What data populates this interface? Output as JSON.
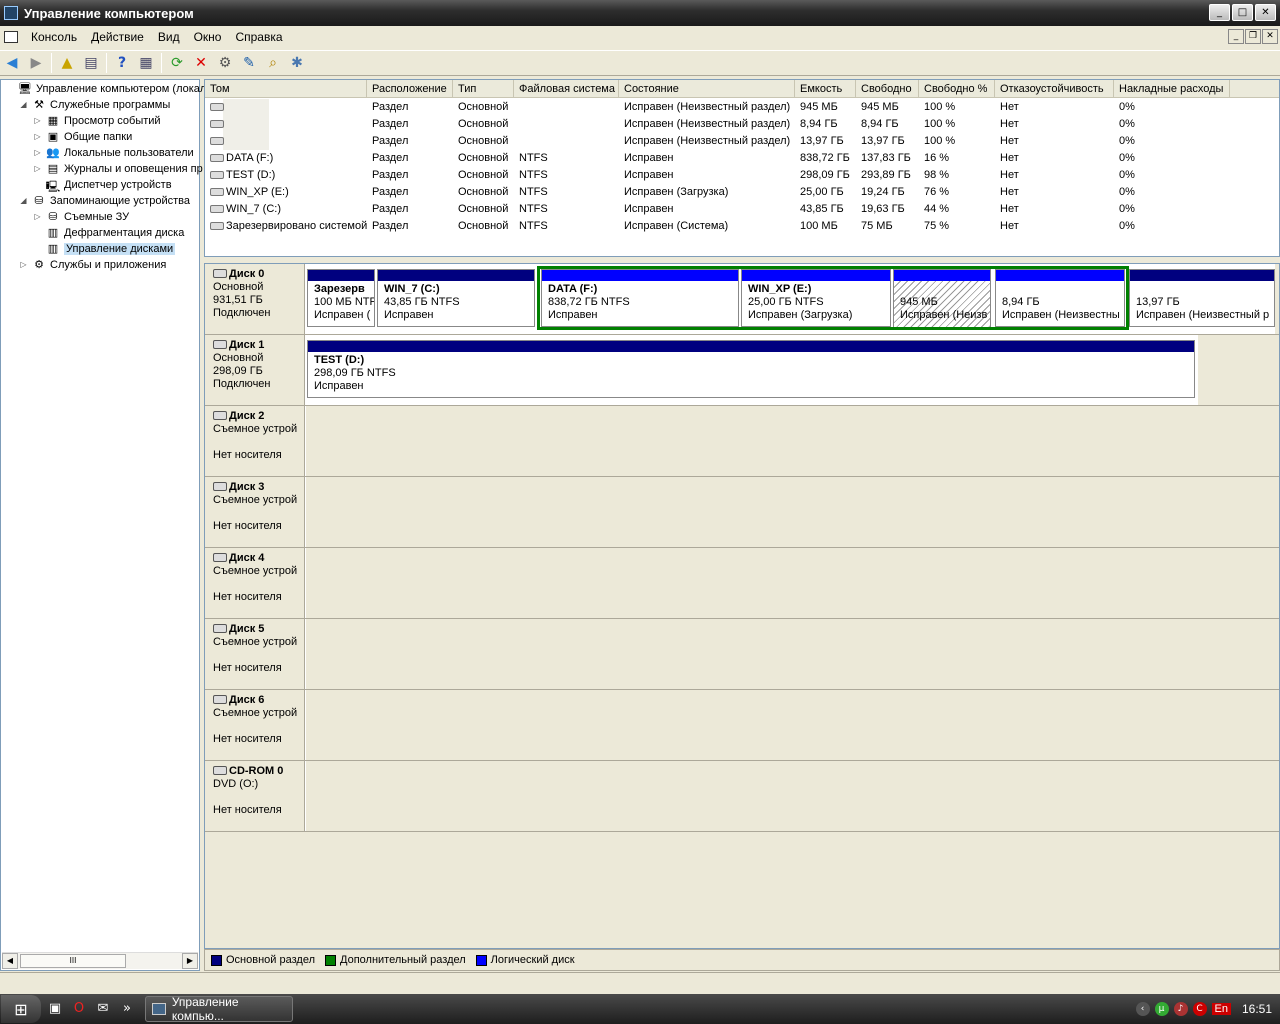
{
  "window": {
    "title": "Управление компьютером"
  },
  "menu": [
    "Консоль",
    "Действие",
    "Вид",
    "Окно",
    "Справка"
  ],
  "tree": {
    "items": [
      {
        "label": "Управление компьютером (локаль",
        "level": 0,
        "exp": ""
      },
      {
        "label": "Служебные программы",
        "level": 1,
        "exp": "◢"
      },
      {
        "label": "Просмотр событий",
        "level": 2,
        "exp": "▷"
      },
      {
        "label": "Общие папки",
        "level": 2,
        "exp": "▷"
      },
      {
        "label": "Локальные пользователи",
        "level": 2,
        "exp": "▷"
      },
      {
        "label": "Журналы и оповещения пр",
        "level": 2,
        "exp": "▷"
      },
      {
        "label": "Диспетчер устройств",
        "level": 2,
        "exp": ""
      },
      {
        "label": "Запоминающие устройства",
        "level": 1,
        "exp": "◢"
      },
      {
        "label": "Съемные ЗУ",
        "level": 2,
        "exp": "▷"
      },
      {
        "label": "Дефрагментация диска",
        "level": 2,
        "exp": ""
      },
      {
        "label": "Управление дисками",
        "level": 2,
        "exp": "",
        "selected": true
      },
      {
        "label": "Службы и приложения",
        "level": 1,
        "exp": "▷"
      }
    ],
    "scroll_thumb": "III"
  },
  "table": {
    "headers": [
      "Том",
      "Расположение",
      "Тип",
      "Файловая система",
      "Состояние",
      "Емкость",
      "Свободно",
      "Свободно %",
      "Отказоустойчивость",
      "Накладные расходы"
    ],
    "rows": [
      [
        "",
        "Раздел",
        "Основной",
        "",
        "Исправен (Неизвестный раздел)",
        "945 МБ",
        "945 МБ",
        "100 %",
        "Нет",
        "0%"
      ],
      [
        "",
        "Раздел",
        "Основной",
        "",
        "Исправен (Неизвестный раздел)",
        "8,94 ГБ",
        "8,94 ГБ",
        "100 %",
        "Нет",
        "0%"
      ],
      [
        "",
        "Раздел",
        "Основной",
        "",
        "Исправен (Неизвестный раздел)",
        "13,97 ГБ",
        "13,97 ГБ",
        "100 %",
        "Нет",
        "0%"
      ],
      [
        "DATA (F:)",
        "Раздел",
        "Основной",
        "NTFS",
        "Исправен",
        "838,72 ГБ",
        "137,83 ГБ",
        "16 %",
        "Нет",
        "0%"
      ],
      [
        "TEST (D:)",
        "Раздел",
        "Основной",
        "NTFS",
        "Исправен",
        "298,09 ГБ",
        "293,89 ГБ",
        "98 %",
        "Нет",
        "0%"
      ],
      [
        "WIN_XP (E:)",
        "Раздел",
        "Основной",
        "NTFS",
        "Исправен (Загрузка)",
        "25,00 ГБ",
        "19,24 ГБ",
        "76 %",
        "Нет",
        "0%"
      ],
      [
        "WIN_7 (C:)",
        "Раздел",
        "Основной",
        "NTFS",
        "Исправен",
        "43,85 ГБ",
        "19,63 ГБ",
        "44 %",
        "Нет",
        "0%"
      ],
      [
        "Зарезервировано системой",
        "Раздел",
        "Основной",
        "NTFS",
        "Исправен (Система)",
        "100 МБ",
        "75 МБ",
        "75 %",
        "Нет",
        "0%"
      ]
    ]
  },
  "disks": [
    {
      "name": "Диск 0",
      "type": "Основной",
      "size": "931,51 ГБ",
      "status": "Подключен",
      "partitions": [
        {
          "title": "Зарезерв",
          "size": "100 МБ NTF",
          "state": "Исправен (",
          "bar": "primary"
        },
        {
          "title": "WIN_7  (C:)",
          "size": "43,85 ГБ NTFS",
          "state": "Исправен",
          "bar": "primary"
        },
        {
          "title": "DATA  (F:)",
          "size": "838,72 ГБ NTFS",
          "state": "Исправен",
          "bar": "logical"
        },
        {
          "title": "WIN_XP  (E:)",
          "size": "25,00 ГБ NTFS",
          "state": "Исправен (Загрузка)",
          "bar": "logical"
        },
        {
          "title": "",
          "size": "945 МБ",
          "state": "Исправен (Неизв",
          "bar": "logical"
        },
        {
          "title": "",
          "size": "8,94 ГБ",
          "state": "Исправен (Неизвестны",
          "bar": "logical"
        },
        {
          "title": "",
          "size": "13,97 ГБ",
          "state": "Исправен (Неизвестный р",
          "bar": "primary"
        }
      ]
    },
    {
      "name": "Диск 1",
      "type": "Основной",
      "size": "298,09 ГБ",
      "status": "Подключен",
      "partitions": [
        {
          "title": "TEST  (D:)",
          "size": "298,09 ГБ NTFS",
          "state": "Исправен",
          "bar": "primary"
        }
      ]
    },
    {
      "name": "Диск 2",
      "type": "Съемное устрой",
      "status": "Нет носителя"
    },
    {
      "name": "Диск 3",
      "type": "Съемное устрой",
      "status": "Нет носителя"
    },
    {
      "name": "Диск 4",
      "type": "Съемное устрой",
      "status": "Нет носителя"
    },
    {
      "name": "Диск 5",
      "type": "Съемное устрой",
      "status": "Нет носителя"
    },
    {
      "name": "Диск 6",
      "type": "Съемное устрой",
      "status": "Нет носителя"
    },
    {
      "name": "CD-ROM 0",
      "type": "DVD (O:)",
      "status": "Нет носителя"
    }
  ],
  "legend": [
    {
      "label": "Основной раздел",
      "color": "#00007f"
    },
    {
      "label": "Дополнительный раздел",
      "color": "#008000"
    },
    {
      "label": "Логический диск",
      "color": "#0000ff"
    }
  ],
  "taskbar": {
    "button": "Управление компью...",
    "lang": "En",
    "clock": "16:51"
  }
}
